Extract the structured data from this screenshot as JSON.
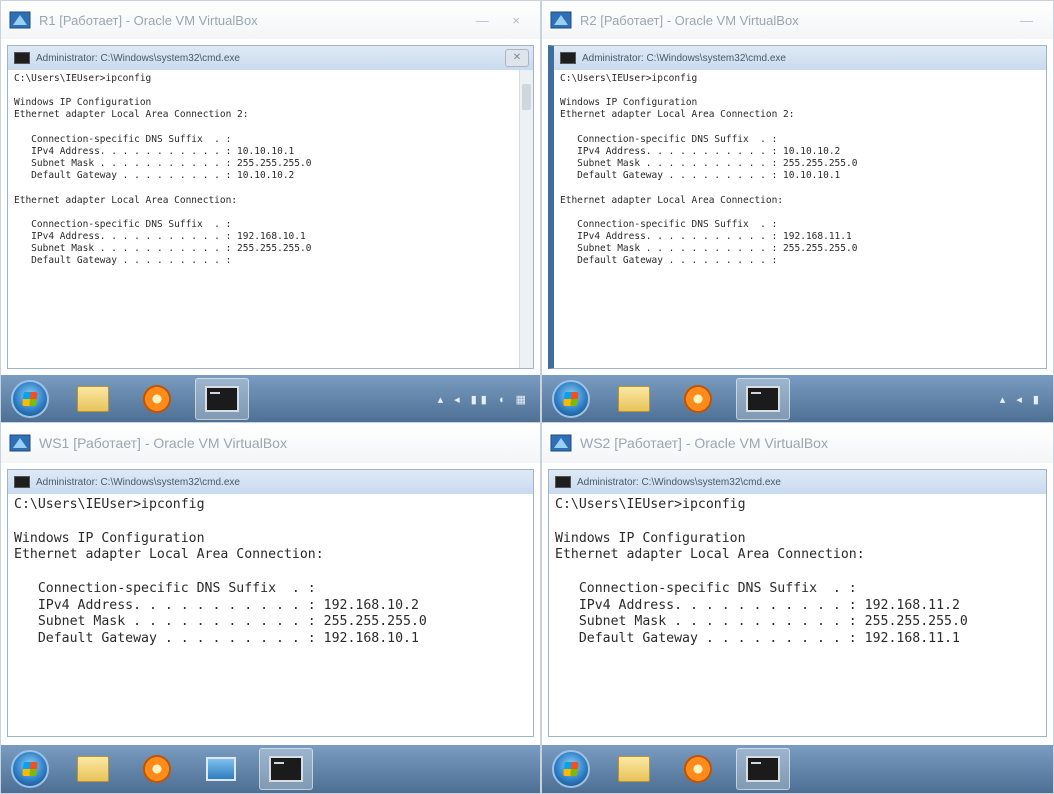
{
  "vms": [
    {
      "title": "R1 [Работает] - Oracle VM VirtualBox",
      "cmd_title": "Administrator: C:\\Windows\\system32\\cmd.exe",
      "console_lines": [
        "C:\\Users\\IEUser>ipconfig",
        "",
        "Windows IP Configuration",
        "Ethernet adapter Local Area Connection 2:",
        "",
        "   Connection-specific DNS Suffix  . :",
        "   IPv4 Address. . . . . . . . . . . : 10.10.10.1",
        "   Subnet Mask . . . . . . . . . . . : 255.255.255.0",
        "   Default Gateway . . . . . . . . . : 10.10.10.2",
        "",
        "Ethernet adapter Local Area Connection:",
        "",
        "   Connection-specific DNS Suffix  . :",
        "   IPv4 Address. . . . . . . . . . . : 192.168.10.1",
        "   Subnet Mask . . . . . . . . . . . : 255.255.255.0",
        "   Default Gateway . . . . . . . . . :"
      ]
    },
    {
      "title": "R2 [Работает] - Oracle VM VirtualBox",
      "cmd_title": "Administrator: C:\\Windows\\system32\\cmd.exe",
      "console_lines": [
        "C:\\Users\\IEUser>ipconfig",
        "",
        "Windows IP Configuration",
        "Ethernet adapter Local Area Connection 2:",
        "",
        "   Connection-specific DNS Suffix  . :",
        "   IPv4 Address. . . . . . . . . . . : 10.10.10.2",
        "   Subnet Mask . . . . . . . . . . . : 255.255.255.0",
        "   Default Gateway . . . . . . . . . : 10.10.10.1",
        "",
        "Ethernet adapter Local Area Connection:",
        "",
        "   Connection-specific DNS Suffix  . :",
        "   IPv4 Address. . . . . . . . . . . : 192.168.11.1",
        "   Subnet Mask . . . . . . . . . . . : 255.255.255.0",
        "   Default Gateway . . . . . . . . . :"
      ]
    },
    {
      "title": "WS1 [Работает] - Oracle VM VirtualBox",
      "cmd_title": "Administrator: C:\\Windows\\system32\\cmd.exe",
      "console_lines": [
        "C:\\Users\\IEUser>ipconfig",
        "",
        "Windows IP Configuration",
        "Ethernet adapter Local Area Connection:",
        "",
        "   Connection-specific DNS Suffix  . :",
        "   IPv4 Address. . . . . . . . . . . : 192.168.10.2",
        "   Subnet Mask . . . . . . . . . . . : 255.255.255.0",
        "   Default Gateway . . . . . . . . . : 192.168.10.1"
      ]
    },
    {
      "title": "WS2 [Работает] - Oracle VM VirtualBox",
      "cmd_title": "Administrator: C:\\Windows\\system32\\cmd.exe",
      "console_lines": [
        "C:\\Users\\IEUser>ipconfig",
        "",
        "Windows IP Configuration",
        "Ethernet adapter Local Area Connection:",
        "",
        "   Connection-specific DNS Suffix  . :",
        "   IPv4 Address. . . . . . . . . . . : 192.168.11.2",
        "   Subnet Mask . . . . . . . . . . . : 255.255.255.0",
        "   Default Gateway . . . . . . . . . : 192.168.11.1"
      ]
    }
  ],
  "icons": {
    "vm_icon": "virtualbox-icon",
    "start": "windows-start-icon",
    "explorer": "folder-icon",
    "media": "media-player-icon",
    "cmd": "command-prompt-icon",
    "monitor": "monitor-icon"
  },
  "colors": {
    "taskbar": "#5e82a8",
    "console_text": "#2a2a2a",
    "titlebar_text": "#9aa6b2"
  }
}
